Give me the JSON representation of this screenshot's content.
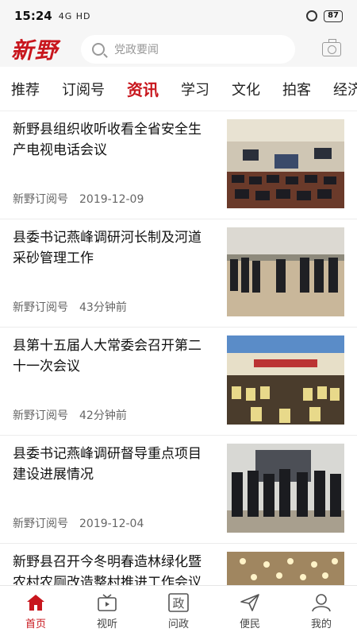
{
  "status": {
    "time": "15:24",
    "signal": "4G HD",
    "battery": "87"
  },
  "header": {
    "logo": "新野",
    "search_placeholder": "党政要闻"
  },
  "tabs": [
    "推荐",
    "订阅号",
    "资讯",
    "学习",
    "文化",
    "拍客",
    "经济"
  ],
  "active_tab": "资讯",
  "articles": [
    {
      "title": "新野县组织收听收看全省安全生产电视电话会议",
      "source": "新野订阅号",
      "time": "2019-12-09",
      "image": "meeting-hall-photo"
    },
    {
      "title": "县委书记燕峰调研河长制及河道采砂管理工作",
      "source": "新野订阅号",
      "time": "43分钟前",
      "image": "riverbank-inspection-photo"
    },
    {
      "title": "县第十五届人大常委会召开第二十一次会议",
      "source": "新野订阅号",
      "time": "42分钟前",
      "image": "conference-room-photo"
    },
    {
      "title": "县委书记燕峰调研督导重点项目建设进展情况",
      "source": "新野订阅号",
      "time": "2019-12-04",
      "image": "project-site-photo"
    },
    {
      "title": "新野县召开今冬明春造林绿化暨农村农厕改造整村推进工作会议",
      "source": "",
      "time": "",
      "image": "meeting-ceiling-photo"
    }
  ],
  "bottom_nav": [
    {
      "label": "首页",
      "icon": "home-icon",
      "active": true
    },
    {
      "label": "视听",
      "icon": "tv-icon",
      "active": false
    },
    {
      "label": "问政",
      "icon": "zheng-icon",
      "glyph": "政",
      "active": false
    },
    {
      "label": "便民",
      "icon": "send-icon",
      "active": false
    },
    {
      "label": "我的",
      "icon": "user-icon",
      "active": false
    }
  ],
  "colors": {
    "accent": "#c8161d",
    "background": "#f6f6f6"
  }
}
